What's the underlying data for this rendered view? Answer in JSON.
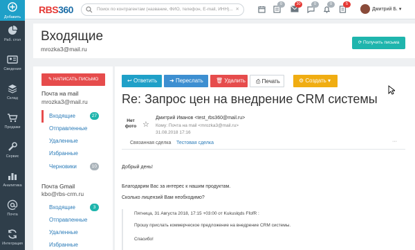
{
  "sidebar": {
    "add_label": "Добавить",
    "items": [
      {
        "label": "Раб. стол",
        "icon": "pie-chart-icon"
      },
      {
        "label": "Сведения",
        "icon": "id-card-icon"
      },
      {
        "label": "Склад",
        "icon": "layers-icon"
      },
      {
        "label": "Продажи",
        "icon": "cart-icon"
      },
      {
        "label": "Сервис",
        "icon": "wrench-icon"
      },
      {
        "label": "Аналитика",
        "icon": "bar-chart-icon"
      },
      {
        "label": "Почта",
        "icon": "at-icon"
      },
      {
        "label": "Интеграция",
        "icon": "sync-icon"
      }
    ]
  },
  "topbar": {
    "logo_text": "RBS",
    "logo_num": "360",
    "search_placeholder": "Поиск по контрагентам (название, ФИО, телефон, E-mail, ИНН)...",
    "badges": {
      "tasks": "0",
      "mail": "30",
      "chat": "0",
      "bell": "0",
      "notes": "5"
    },
    "user_name": "Дмитрий Б."
  },
  "header": {
    "title": "Входящие",
    "subtitle": "mrozka3@mail.ru",
    "fetch_label": "Получить письма"
  },
  "left": {
    "compose_label": "НАПИСАТЬ ПИСЬМО",
    "account1": {
      "title": "Почта на mail",
      "email": "mrozka3@mail.ru"
    },
    "account1_folders": [
      {
        "label": "Входящие",
        "count": "27"
      },
      {
        "label": "Отправленные"
      },
      {
        "label": "Удаленные"
      },
      {
        "label": "Избранные"
      },
      {
        "label": "Черновики",
        "count": "10"
      }
    ],
    "account2": {
      "title": "Почта Gmail",
      "email": "kbo@rbs-crm.ru"
    },
    "account2_folders": [
      {
        "label": "Входящие",
        "count": "3"
      },
      {
        "label": "Отправленные"
      },
      {
        "label": "Удаленные"
      },
      {
        "label": "Избранные"
      }
    ]
  },
  "toolbar": {
    "reply": "Ответить",
    "forward": "Переслать",
    "delete": "Удалить",
    "print": "Печать",
    "create": "Создать"
  },
  "message": {
    "subject": "Re: Запрос цен на внедрение CRM системы",
    "no_photo": "Нет фото",
    "from": "Дмитрий Иванов <test_rbs360@mail.ru>",
    "to": "Кому: Почта на mail <mrozka3@mail.ru>",
    "date": "31.08.2018 17:16",
    "related_label": "Связанная сделка",
    "related_value": "Тестовая сделка",
    "related_more": "···",
    "greeting": "Добрый день!",
    "line1": "Благодарим Вас за интерес к нашим продуктам.",
    "line2": "Сколько лицензий Вам необходимо?",
    "quote_header": "Пятница, 31 Августа 2018, 17:15 +03:00 от Kukuslqds FfofR :",
    "quote_line": "Прошу прислать коммерческое предложение на внедрение CRM системы.",
    "quote_thanks": "Спасибо!"
  },
  "colors": {
    "sidebar_bg": "#2f3e4a",
    "accent": "#1fa0c8",
    "reply": "#1fa0c8",
    "forward": "#3d8fd1",
    "delete": "#e64c4c",
    "create": "#f0ad12",
    "fetch": "#1fb5ad",
    "compose": "#e64c4c"
  }
}
